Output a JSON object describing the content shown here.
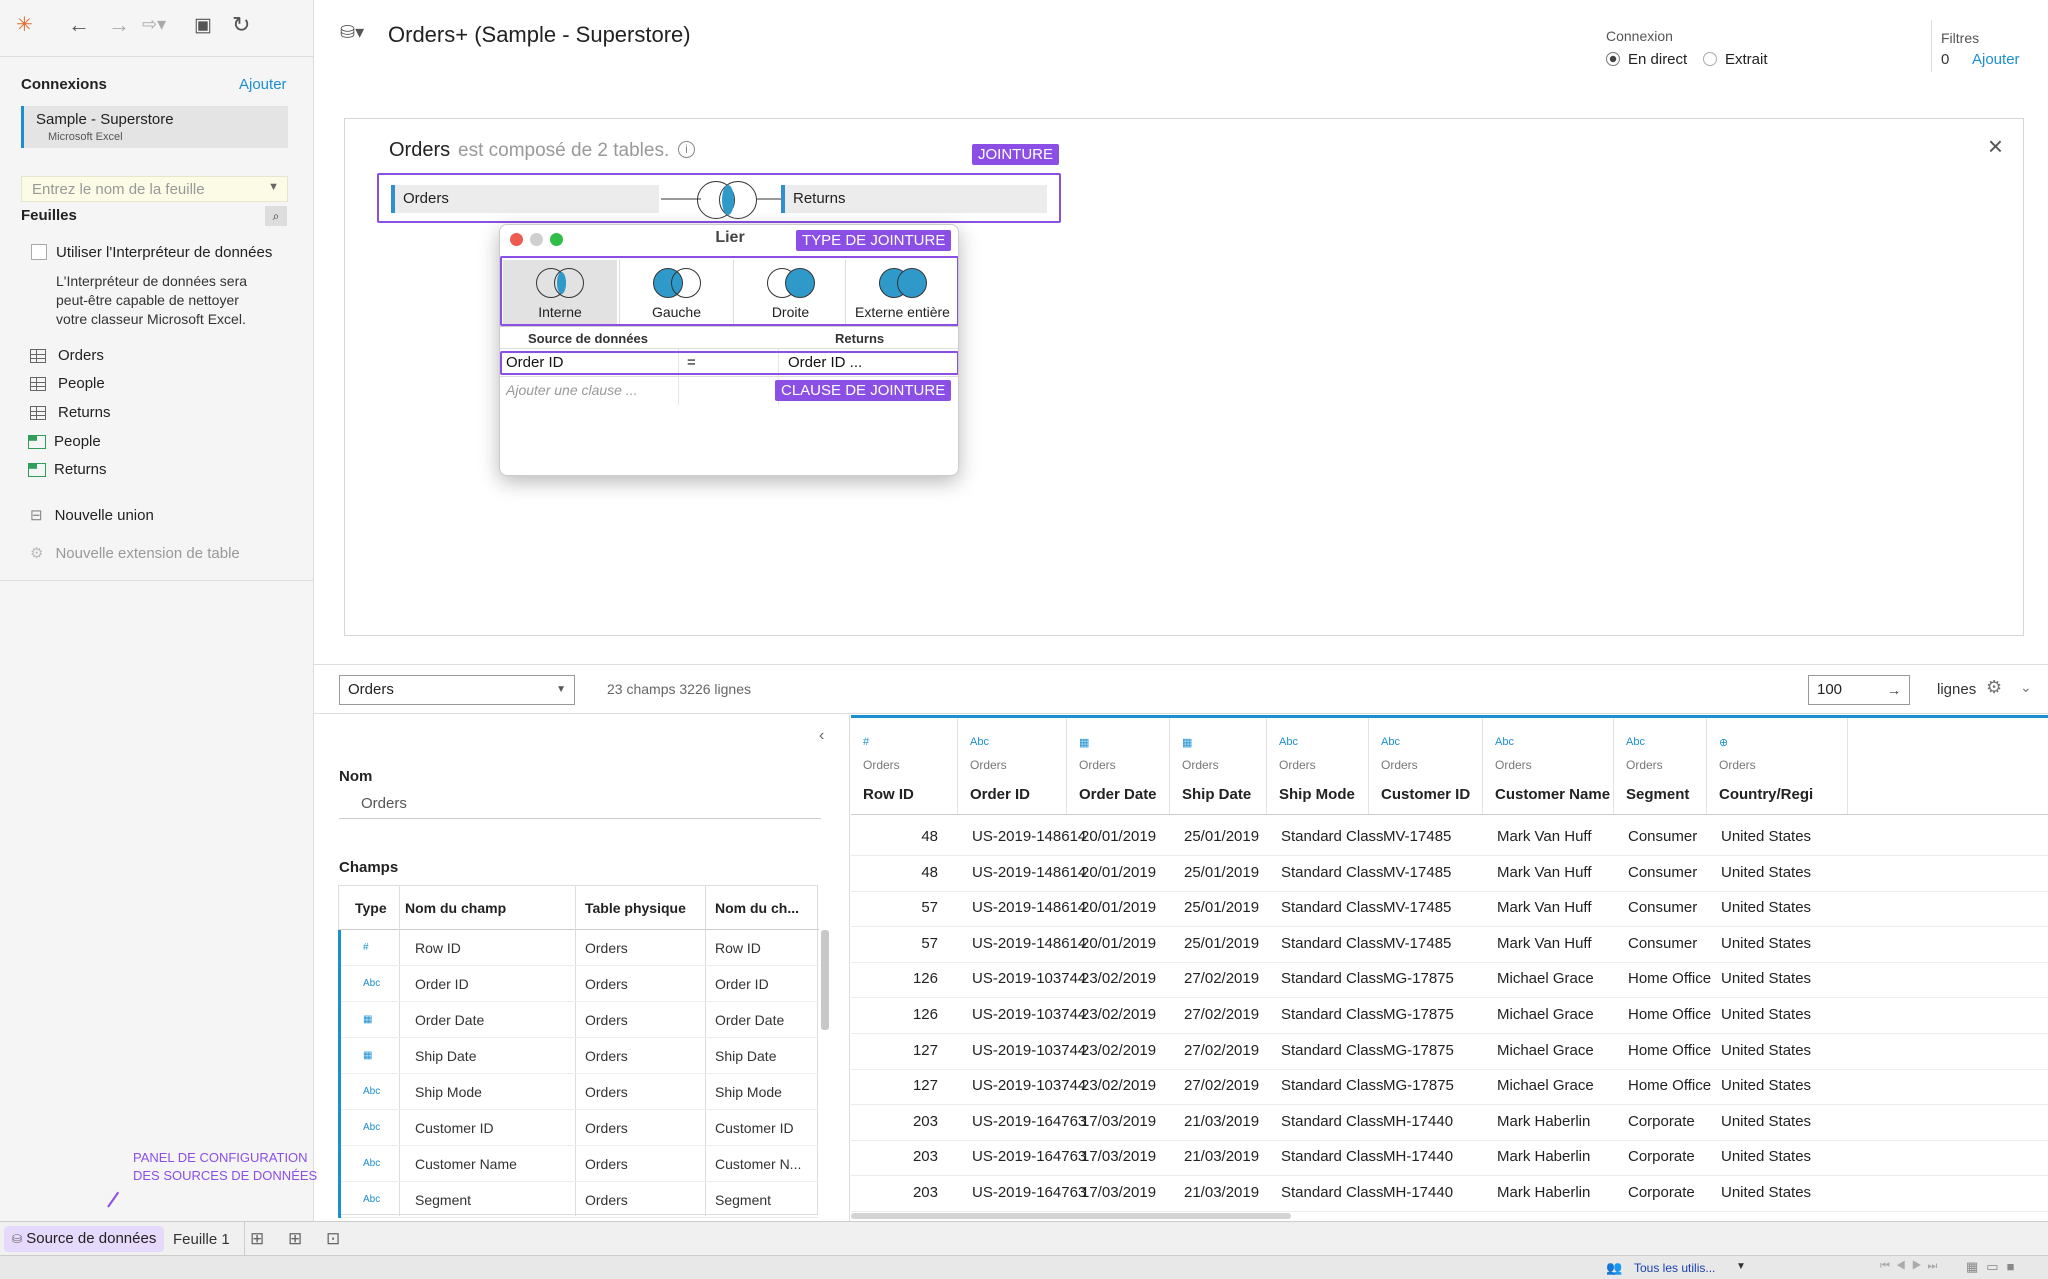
{
  "toolbar": {
    "icons": [
      "tableau-logo-icon",
      "back-arrow-icon",
      "forward-arrow-icon",
      "redo-icon",
      "save-icon",
      "refresh-icon"
    ]
  },
  "sidebar": {
    "connections_label": "Connexions",
    "add_label": "Ajouter",
    "connection": {
      "name": "Sample - Superstore",
      "type": "Microsoft Excel"
    },
    "sheet_search_placeholder": "Entrez le nom de la feuille",
    "sheets_label": "Feuilles",
    "interpreter_label": "Utiliser l'Interpréteur de données",
    "interpreter_desc_1": "L'Interpréteur de données sera",
    "interpreter_desc_2": "peut-être capable de nettoyer",
    "interpreter_desc_3": "votre classeur Microsoft Excel.",
    "sheets": [
      {
        "label": "Orders",
        "kind": "table"
      },
      {
        "label": "People",
        "kind": "table"
      },
      {
        "label": "Returns",
        "kind": "table"
      },
      {
        "label": "People",
        "kind": "named-range"
      },
      {
        "label": "Returns",
        "kind": "named-range"
      }
    ],
    "new_union": "Nouvelle union",
    "new_extension": "Nouvelle extension de table"
  },
  "header": {
    "title": "Orders+ (Sample - Superstore)",
    "connection_label": "Connexion",
    "live_label": "En direct",
    "extract_label": "Extrait",
    "filters_label": "Filtres",
    "filters_count": "0",
    "filters_add": "Ajouter"
  },
  "canvas": {
    "heading_table": "Orders",
    "heading_rest": "est composé de 2 tables.",
    "left_table": "Orders",
    "right_table": "Returns",
    "tag_join": "JOINTURE",
    "tag_join_type": "TYPE DE JOINTURE",
    "tag_join_clause": "CLAUSE DE JOINTURE",
    "tag_panel_1": "PANEL DE CONFIGURATION",
    "tag_panel_2": "DES SOURCES DE DONNÉES"
  },
  "dialog": {
    "title": "Lier",
    "join_types": [
      "Interne",
      "Gauche",
      "Droite",
      "Externe entière"
    ],
    "col_source": "Source de données",
    "col_returns": "Returns",
    "clause_left": "Order ID",
    "clause_op": "=",
    "clause_right": "Order ID ...",
    "add_clause": "Ajouter une clause ..."
  },
  "bottom": {
    "table_select": "Orders",
    "summary": "23 champs 3226 lignes",
    "rows_value": "100",
    "rows_label": "lignes"
  },
  "meta": {
    "name_label": "Nom",
    "name_value": "Orders",
    "fields_label": "Champs",
    "headers": [
      "Type",
      "Nom du champ",
      "Table physique",
      "Nom du ch..."
    ],
    "rows": [
      {
        "type": "#",
        "field": "Row ID",
        "table": "Orders",
        "orig": "Row ID"
      },
      {
        "type": "Abc",
        "field": "Order ID",
        "table": "Orders",
        "orig": "Order ID"
      },
      {
        "type": "date",
        "field": "Order Date",
        "table": "Orders",
        "orig": "Order Date"
      },
      {
        "type": "date",
        "field": "Ship Date",
        "table": "Orders",
        "orig": "Ship Date"
      },
      {
        "type": "Abc",
        "field": "Ship Mode",
        "table": "Orders",
        "orig": "Ship Mode"
      },
      {
        "type": "Abc",
        "field": "Customer ID",
        "table": "Orders",
        "orig": "Customer ID"
      },
      {
        "type": "Abc",
        "field": "Customer Name",
        "table": "Orders",
        "orig": "Customer N..."
      },
      {
        "type": "Abc",
        "field": "Segment",
        "table": "Orders",
        "orig": "Segment"
      }
    ]
  },
  "grid": {
    "columns": [
      {
        "icon": "#",
        "table": "Orders",
        "name": "Row ID"
      },
      {
        "icon": "Abc",
        "table": "Orders",
        "name": "Order ID"
      },
      {
        "icon": "date",
        "table": "Orders",
        "name": "Order Date"
      },
      {
        "icon": "date",
        "table": "Orders",
        "name": "Ship Date"
      },
      {
        "icon": "Abc",
        "table": "Orders",
        "name": "Ship Mode"
      },
      {
        "icon": "Abc",
        "table": "Orders",
        "name": "Customer ID"
      },
      {
        "icon": "Abc",
        "table": "Orders",
        "name": "Customer Name"
      },
      {
        "icon": "Abc",
        "table": "Orders",
        "name": "Segment"
      },
      {
        "icon": "globe",
        "table": "Orders",
        "name": "Country/Regi"
      }
    ],
    "rows": [
      [
        "48",
        "US-2019-148614",
        "20/01/2019",
        "25/01/2019",
        "Standard Class",
        "MV-17485",
        "Mark Van Huff",
        "Consumer",
        "United States"
      ],
      [
        "48",
        "US-2019-148614",
        "20/01/2019",
        "25/01/2019",
        "Standard Class",
        "MV-17485",
        "Mark Van Huff",
        "Consumer",
        "United States"
      ],
      [
        "57",
        "US-2019-148614",
        "20/01/2019",
        "25/01/2019",
        "Standard Class",
        "MV-17485",
        "Mark Van Huff",
        "Consumer",
        "United States"
      ],
      [
        "57",
        "US-2019-148614",
        "20/01/2019",
        "25/01/2019",
        "Standard Class",
        "MV-17485",
        "Mark Van Huff",
        "Consumer",
        "United States"
      ],
      [
        "126",
        "US-2019-103744",
        "23/02/2019",
        "27/02/2019",
        "Standard Class",
        "MG-17875",
        "Michael Grace",
        "Home Office",
        "United States"
      ],
      [
        "126",
        "US-2019-103744",
        "23/02/2019",
        "27/02/2019",
        "Standard Class",
        "MG-17875",
        "Michael Grace",
        "Home Office",
        "United States"
      ],
      [
        "127",
        "US-2019-103744",
        "23/02/2019",
        "27/02/2019",
        "Standard Class",
        "MG-17875",
        "Michael Grace",
        "Home Office",
        "United States"
      ],
      [
        "127",
        "US-2019-103744",
        "23/02/2019",
        "27/02/2019",
        "Standard Class",
        "MG-17875",
        "Michael Grace",
        "Home Office",
        "United States"
      ],
      [
        "203",
        "US-2019-164763",
        "17/03/2019",
        "21/03/2019",
        "Standard Class",
        "MH-17440",
        "Mark Haberlin",
        "Corporate",
        "United States"
      ],
      [
        "203",
        "US-2019-164763",
        "17/03/2019",
        "21/03/2019",
        "Standard Class",
        "MH-17440",
        "Mark Haberlin",
        "Corporate",
        "United States"
      ],
      [
        "203",
        "US-2019-164763",
        "17/03/2019",
        "21/03/2019",
        "Standard Class",
        "MH-17440",
        "Mark Haberlin",
        "Corporate",
        "United States"
      ]
    ]
  },
  "footer": {
    "datasource_tab": "Source de données",
    "sheet_tab": "Feuille 1",
    "user_filter": "Tous les utilis..."
  },
  "colors": {
    "accent": "#1b8fd1",
    "annotation": "#8b4fe6"
  }
}
